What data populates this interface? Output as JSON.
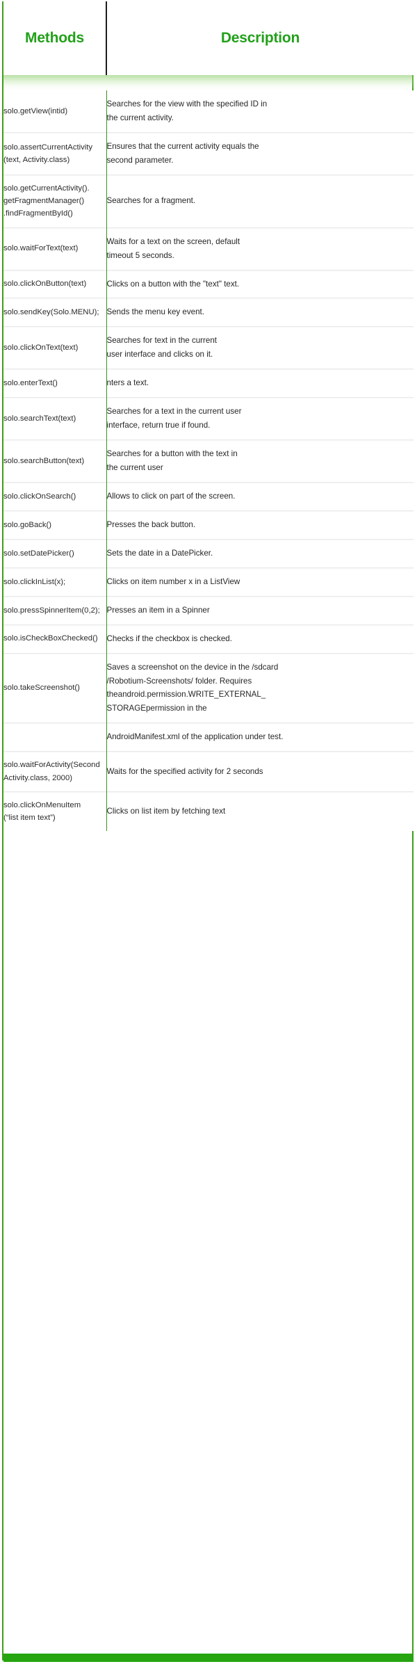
{
  "table": {
    "columns": [
      {
        "label": "Methods"
      },
      {
        "label": "Description"
      }
    ],
    "rows": [
      {
        "method": "solo.getView(intid)",
        "description": "Searches for the view with the specified ID in\nthe current activity."
      },
      {
        "method": "solo.assertCurrentActivity\n(text, Activity.class)",
        "description": "Ensures that the current activity equals the\nsecond parameter."
      },
      {
        "method": "solo.getCurrentActivity().\ngetFragmentManager()\n.findFragmentById()",
        "description": "Searches for a fragment."
      },
      {
        "method": "solo.waitForText(text)",
        "description": "Waits for a text on the screen, default\ntimeout 5 seconds."
      },
      {
        "method": "solo.clickOnButton(text)",
        "description": "Clicks on a button with the \"text\" text."
      },
      {
        "method": "solo.sendKey(Solo.MENU);",
        "description": "Sends the menu key event."
      },
      {
        "method": "solo.clickOnText(text)",
        "description": "Searches for text in the current\nuser interface and clicks on it."
      },
      {
        "method": "solo.enterText()",
        "description": "nters a text."
      },
      {
        "method": "solo.searchText(text)",
        "description": "Searches for a text in the current user\ninterface, return true if found."
      },
      {
        "method": "solo.searchButton(text)",
        "description": "Searches for a button with the text in\nthe current user"
      },
      {
        "method": "solo.clickOnSearch()",
        "description": "Allows to click on part of the screen."
      },
      {
        "method": "solo.goBack()",
        "description": "Presses the back button."
      },
      {
        "method": "solo.setDatePicker()",
        "description": "Sets the date in a DatePicker."
      },
      {
        "method": "solo.clickInList(x);",
        "description": "Clicks on item number x in a ListView"
      },
      {
        "method": "solo.pressSpinnerItem(0,2);",
        "description": "Presses an item in a Spinner"
      },
      {
        "method": "solo.isCheckBoxChecked()",
        "description": "Checks if the checkbox is checked."
      },
      {
        "method": "solo.takeScreenshot()",
        "description": "Saves a screenshot on the device in the /sdcard\n/Robotium-Screenshots/ folder. Requires\ntheandroid.permission.WRITE_EXTERNAL_\nSTORAGEpermission in the"
      },
      {
        "method": "",
        "description": "AndroidManifest.xml of the application under test."
      },
      {
        "method": "solo.waitForActivity(Second\nActivity.class, 2000)",
        "description": "Waits for the specified activity for 2 seconds"
      },
      {
        "method": "solo.clickOnMenuItem\n(“list item text”)",
        "description": "Clicks on list item by fetching text"
      }
    ]
  },
  "colors": {
    "heading_green": "#22a01a",
    "frame_green": "#3aa017",
    "divider_green": "#3e8e1e",
    "bottom_bar_green": "#26a510",
    "header_divider": "#1b1b1b",
    "body_text": "#2a2a2a"
  }
}
